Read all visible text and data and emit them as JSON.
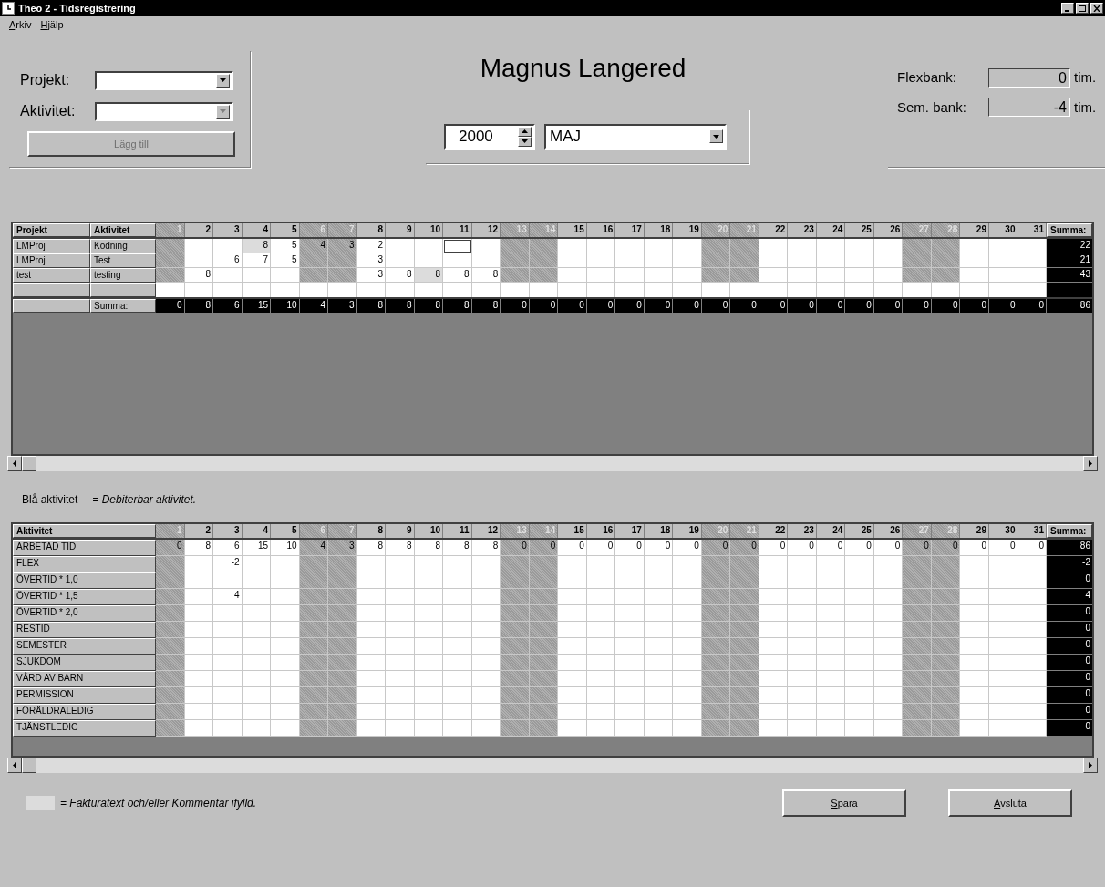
{
  "window": {
    "title": "Theo 2 - Tidsregistrering"
  },
  "menu": [
    {
      "label": "Arkiv"
    },
    {
      "label": "Hjälp"
    }
  ],
  "form": {
    "project_label": "Projekt:",
    "activity_label": "Aktivitet:",
    "add_button": {
      "label": "Lägg till",
      "disabled": true
    }
  },
  "employee": "Magnus Langered",
  "period": {
    "year": "2000",
    "month": "MAJ"
  },
  "banks": [
    {
      "label": "Flexbank:",
      "value": "0",
      "unit": "tim."
    },
    {
      "label": "Sem. bank:",
      "value": "-4",
      "unit": "tim."
    }
  ],
  "project_grid": {
    "columns": {
      "project": "Projekt",
      "activity": "Aktivitet",
      "sum": "Summa:"
    },
    "days": [
      {
        "label": "1",
        "weekend": true
      },
      {
        "label": "2",
        "weekend": false
      },
      {
        "label": "3",
        "weekend": false
      },
      {
        "label": "4",
        "weekend": false
      },
      {
        "label": "5",
        "weekend": false
      },
      {
        "label": "6",
        "weekend": true
      },
      {
        "label": "7",
        "weekend": true
      },
      {
        "label": "8",
        "weekend": false
      },
      {
        "label": "9",
        "weekend": false
      },
      {
        "label": "10",
        "weekend": false
      },
      {
        "label": "11",
        "weekend": false
      },
      {
        "label": "12",
        "weekend": false
      },
      {
        "label": "13",
        "weekend": true
      },
      {
        "label": "14",
        "weekend": true
      },
      {
        "label": "15",
        "weekend": false
      },
      {
        "label": "16",
        "weekend": false
      },
      {
        "label": "17",
        "weekend": false
      },
      {
        "label": "18",
        "weekend": false
      },
      {
        "label": "19",
        "weekend": false
      },
      {
        "label": "20",
        "weekend": true
      },
      {
        "label": "21",
        "weekend": true
      },
      {
        "label": "22",
        "weekend": false
      },
      {
        "label": "23",
        "weekend": false
      },
      {
        "label": "24",
        "weekend": false
      },
      {
        "label": "25",
        "weekend": false
      },
      {
        "label": "26",
        "weekend": false
      },
      {
        "label": "27",
        "weekend": true
      },
      {
        "label": "28",
        "weekend": true
      },
      {
        "label": "29",
        "weekend": false
      },
      {
        "label": "30",
        "weekend": false
      },
      {
        "label": "31",
        "weekend": false
      }
    ],
    "rows": [
      {
        "kind": "entry",
        "project": "LMProj",
        "activity": "Kodning",
        "sum": "22",
        "cells": [
          {},
          {},
          {},
          {
            "value": "8",
            "comment": true
          },
          {
            "value": "5"
          },
          {
            "value": "4"
          },
          {
            "value": "3"
          },
          {
            "value": "2"
          },
          {},
          {},
          {
            "selected": true
          },
          {},
          {},
          {},
          {},
          {},
          {},
          {},
          {},
          {},
          {},
          {},
          {},
          {},
          {},
          {},
          {},
          {},
          {},
          {},
          {}
        ]
      },
      {
        "kind": "entry",
        "project": "LMProj",
        "activity": "Test",
        "sum": "21",
        "cells": [
          {},
          {},
          {
            "value": "6"
          },
          {
            "value": "7"
          },
          {
            "value": "5"
          },
          {},
          {},
          {
            "value": "3"
          },
          {},
          {},
          {},
          {},
          {},
          {},
          {},
          {},
          {},
          {},
          {},
          {},
          {},
          {},
          {},
          {},
          {},
          {},
          {},
          {},
          {},
          {},
          {}
        ]
      },
      {
        "kind": "entry",
        "project": "test",
        "activity": "testing",
        "sum": "43",
        "cells": [
          {},
          {
            "value": "8"
          },
          {},
          {},
          {},
          {},
          {},
          {
            "value": "3"
          },
          {
            "value": "8"
          },
          {
            "value": "8",
            "comment": true
          },
          {
            "value": "8"
          },
          {
            "value": "8"
          },
          {},
          {},
          {},
          {},
          {},
          {},
          {},
          {},
          {},
          {},
          {},
          {},
          {},
          {},
          {},
          {},
          {},
          {},
          {}
        ]
      },
      {
        "kind": "blank"
      }
    ],
    "total": {
      "label": "Summa:",
      "values": [
        "0",
        "8",
        "6",
        "15",
        "10",
        "4",
        "3",
        "8",
        "8",
        "8",
        "8",
        "8",
        "0",
        "0",
        "0",
        "0",
        "0",
        "0",
        "0",
        "0",
        "0",
        "0",
        "0",
        "0",
        "0",
        "0",
        "0",
        "0",
        "0",
        "0",
        "0"
      ],
      "sum": "86"
    }
  },
  "legend": {
    "term": "Blå aktivitet",
    "meaning": "= Debiterbar aktivitet."
  },
  "activity_grid": {
    "columns": {
      "activity": "Aktivitet",
      "sum": "Summa:"
    },
    "days": [
      {
        "label": "1",
        "weekend": true
      },
      {
        "label": "2",
        "weekend": false
      },
      {
        "label": "3",
        "weekend": false
      },
      {
        "label": "4",
        "weekend": false
      },
      {
        "label": "5",
        "weekend": false
      },
      {
        "label": "6",
        "weekend": true
      },
      {
        "label": "7",
        "weekend": true
      },
      {
        "label": "8",
        "weekend": false
      },
      {
        "label": "9",
        "weekend": false
      },
      {
        "label": "10",
        "weekend": false
      },
      {
        "label": "11",
        "weekend": false
      },
      {
        "label": "12",
        "weekend": false
      },
      {
        "label": "13",
        "weekend": true
      },
      {
        "label": "14",
        "weekend": true
      },
      {
        "label": "15",
        "weekend": false
      },
      {
        "label": "16",
        "weekend": false
      },
      {
        "label": "17",
        "weekend": false
      },
      {
        "label": "18",
        "weekend": false
      },
      {
        "label": "19",
        "weekend": false
      },
      {
        "label": "20",
        "weekend": true
      },
      {
        "label": "21",
        "weekend": true
      },
      {
        "label": "22",
        "weekend": false
      },
      {
        "label": "23",
        "weekend": false
      },
      {
        "label": "24",
        "weekend": false
      },
      {
        "label": "25",
        "weekend": false
      },
      {
        "label": "26",
        "weekend": false
      },
      {
        "label": "27",
        "weekend": true
      },
      {
        "label": "28",
        "weekend": true
      },
      {
        "label": "29",
        "weekend": false
      },
      {
        "label": "30",
        "weekend": false
      },
      {
        "label": "31",
        "weekend": false
      }
    ],
    "rows": [
      {
        "name": "ARBETAD TID",
        "sum": "86",
        "cells": [
          {
            "value": "0"
          },
          {
            "value": "8"
          },
          {
            "value": "6"
          },
          {
            "value": "15"
          },
          {
            "value": "10"
          },
          {
            "value": "4"
          },
          {
            "value": "3"
          },
          {
            "value": "8"
          },
          {
            "value": "8"
          },
          {
            "value": "8"
          },
          {
            "value": "8"
          },
          {
            "value": "8"
          },
          {
            "value": "0"
          },
          {
            "value": "0"
          },
          {
            "value": "0"
          },
          {
            "value": "0"
          },
          {
            "value": "0"
          },
          {
            "value": "0"
          },
          {
            "value": "0"
          },
          {
            "value": "0"
          },
          {
            "value": "0"
          },
          {
            "value": "0"
          },
          {
            "value": "0"
          },
          {
            "value": "0"
          },
          {
            "value": "0"
          },
          {
            "value": "0"
          },
          {
            "value": "0"
          },
          {
            "value": "0"
          },
          {
            "value": "0"
          },
          {
            "value": "0"
          },
          {
            "value": "0"
          }
        ]
      },
      {
        "name": "FLEX",
        "sum": "-2",
        "cells": [
          {},
          {},
          {
            "value": "-2"
          },
          {},
          {},
          {},
          {},
          {},
          {},
          {},
          {},
          {},
          {},
          {},
          {},
          {},
          {},
          {},
          {},
          {},
          {},
          {},
          {},
          {},
          {},
          {},
          {},
          {},
          {},
          {},
          {}
        ]
      },
      {
        "name": "ÖVERTID * 1,0",
        "sum": "0",
        "cells": []
      },
      {
        "name": "ÖVERTID * 1,5",
        "sum": "4",
        "cells": [
          {},
          {},
          {
            "value": "4"
          },
          {},
          {},
          {},
          {},
          {},
          {},
          {},
          {},
          {},
          {},
          {},
          {},
          {},
          {},
          {},
          {},
          {},
          {},
          {},
          {},
          {},
          {},
          {},
          {},
          {},
          {},
          {},
          {}
        ]
      },
      {
        "name": "ÖVERTID * 2,0",
        "sum": "0",
        "cells": []
      },
      {
        "name": "RESTID",
        "sum": "0",
        "cells": []
      },
      {
        "name": "SEMESTER",
        "sum": "0",
        "cells": []
      },
      {
        "name": "SJUKDOM",
        "sum": "0",
        "cells": []
      },
      {
        "name": "VÅRD AV BARN",
        "sum": "0",
        "cells": []
      },
      {
        "name": "PERMISSION",
        "sum": "0",
        "cells": []
      },
      {
        "name": "FÖRÄLDRALEDIG",
        "sum": "0",
        "cells": []
      },
      {
        "name": "TJÄNSTLEDIG",
        "sum": "0",
        "cells": []
      }
    ]
  },
  "footer": {
    "note": "= Fakturatext och/eller Kommentar ifylld.",
    "buttons": [
      {
        "label": "Spara"
      },
      {
        "label": "Avsluta"
      }
    ]
  }
}
